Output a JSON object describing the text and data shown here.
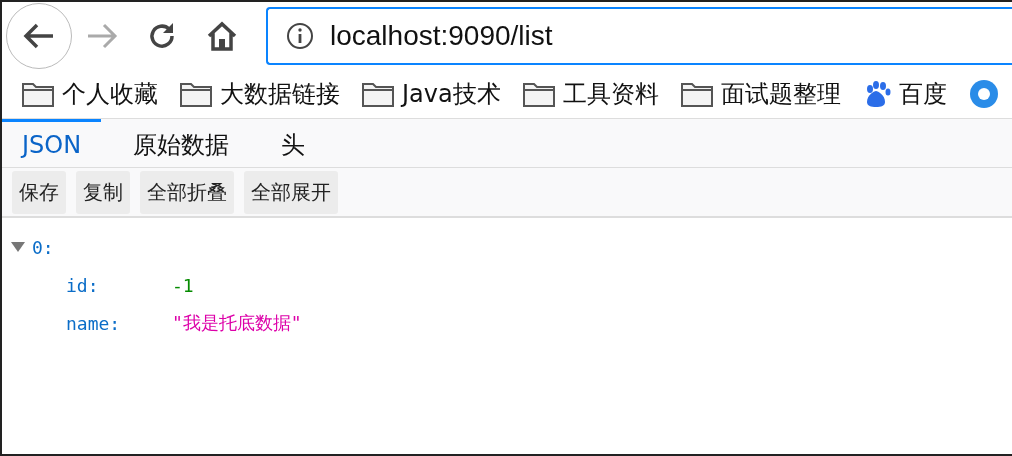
{
  "toolbar": {
    "back": {
      "disabled": false
    },
    "forward": {
      "disabled": true
    },
    "address": {
      "value": "localhost:9090/list"
    }
  },
  "bookmarks": [
    {
      "label": "个人收藏",
      "kind": "folder"
    },
    {
      "label": "大数据链接",
      "kind": "folder"
    },
    {
      "label": "Java技术",
      "kind": "folder"
    },
    {
      "label": "工具资料",
      "kind": "folder"
    },
    {
      "label": "面试题整理",
      "kind": "folder"
    },
    {
      "label": "百度",
      "kind": "paw"
    }
  ],
  "viewer_tabs": [
    {
      "label": "JSON",
      "selected": true
    },
    {
      "label": "原始数据",
      "selected": false
    },
    {
      "label": "头",
      "selected": false
    }
  ],
  "actions": [
    "保存",
    "复制",
    "全部折叠",
    "全部展开"
  ],
  "tree": [
    {
      "key": "0:",
      "expanded": true,
      "children": [
        {
          "key": "id:",
          "value": "-1",
          "kind": "number"
        },
        {
          "key": "name:",
          "value": "\"我是托底数据\"",
          "kind": "string"
        }
      ]
    }
  ]
}
